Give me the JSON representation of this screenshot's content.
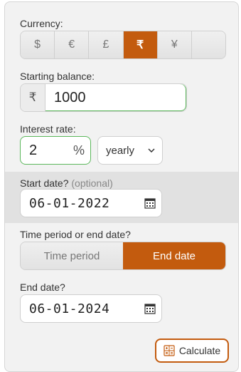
{
  "currency": {
    "label": "Currency:",
    "options": [
      "$",
      "€",
      "£",
      "₹",
      "¥",
      ""
    ],
    "selected": "₹"
  },
  "starting_balance": {
    "label": "Starting balance:",
    "prefix": "₹",
    "value": "1000"
  },
  "interest": {
    "label": "Interest rate:",
    "value": "2",
    "suffix": "%",
    "period": "yearly"
  },
  "start_date": {
    "label": "Start date?",
    "optional": "(optional)",
    "value": "06-01-2022"
  },
  "period_mode": {
    "label": "Time period or end date?",
    "options": [
      "Time period",
      "End date"
    ],
    "selected": "End date"
  },
  "end_date": {
    "label": "End date?",
    "value": "06-01-2024"
  },
  "calculate": {
    "label": "Calculate"
  },
  "icons": [
    "calendar-icon",
    "calculator-icon",
    "chevron-down-icon"
  ],
  "colors": {
    "accent": "#c35b0e",
    "valid_border": "#5cb85c",
    "panel_bg": "#f2f2f2"
  }
}
